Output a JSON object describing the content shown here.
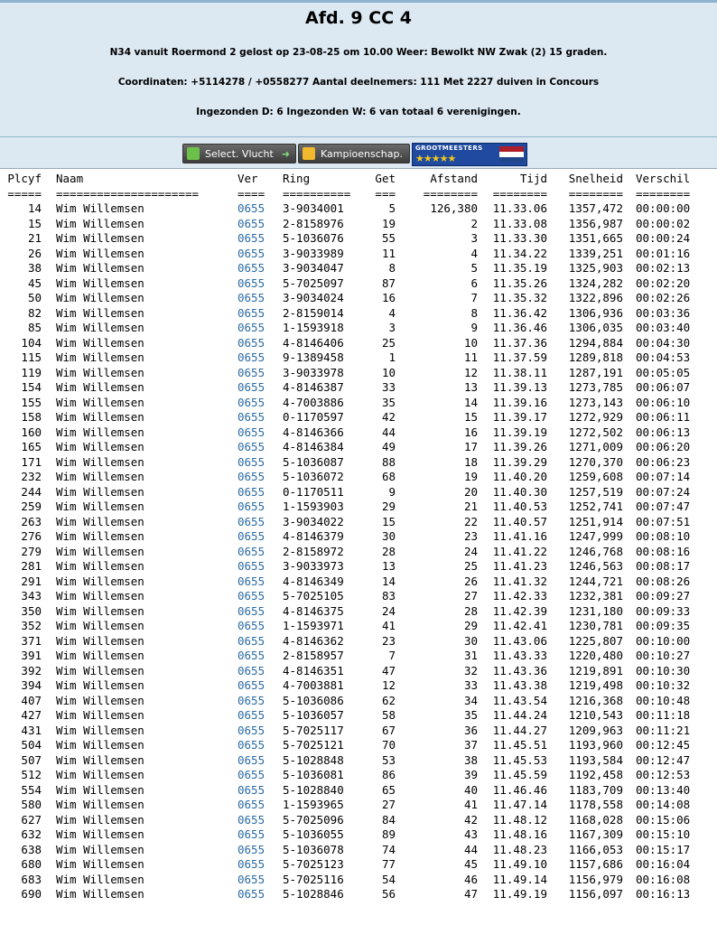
{
  "header": {
    "title": "Afd. 9 CC 4",
    "line1": "N34 vanuit Roermond 2 gelost op 23-08-25 om 10.00 Weer: Bewolkt NW Zwak (2) 15 graden.",
    "line2": "Coordinaten: +5114278 / +0558277 Aantal deelnemers: 111 Met 2227 duiven in Concours",
    "line3": "Ingezonden D: 6 Ingezonden W: 6 van totaal 6 verenigingen."
  },
  "buttons": {
    "select": "Select. Vlucht",
    "kampioen": "Kampioenschap.",
    "grootmeesters": "GROOTMEESTERS",
    "stars": "★★★★★"
  },
  "colors": {
    "header_bg": "#dce8f2",
    "ver_link": "#2a6aa3"
  },
  "table": {
    "columns": [
      "Plcyf",
      "Naam",
      "Ver",
      "Ring",
      "Get",
      "Afstand",
      "Tijd",
      "Snelheid",
      "Verschil"
    ],
    "underline": [
      "=====",
      "=====================",
      "====",
      "==========",
      "===",
      "========",
      "========",
      "========",
      "========"
    ],
    "rows": [
      [
        "14",
        "Wim Willemsen",
        "0655",
        "3-9034001",
        "5",
        "126,380",
        "11.33.06",
        "1357,472",
        "00:00:00"
      ],
      [
        "15",
        "Wim Willemsen",
        "0655",
        "2-8158976",
        "19",
        "2",
        "11.33.08",
        "1356,987",
        "00:00:02"
      ],
      [
        "21",
        "Wim Willemsen",
        "0655",
        "5-1036076",
        "55",
        "3",
        "11.33.30",
        "1351,665",
        "00:00:24"
      ],
      [
        "26",
        "Wim Willemsen",
        "0655",
        "3-9033989",
        "11",
        "4",
        "11.34.22",
        "1339,251",
        "00:01:16"
      ],
      [
        "38",
        "Wim Willemsen",
        "0655",
        "3-9034047",
        "8",
        "5",
        "11.35.19",
        "1325,903",
        "00:02:13"
      ],
      [
        "45",
        "Wim Willemsen",
        "0655",
        "5-7025097",
        "87",
        "6",
        "11.35.26",
        "1324,282",
        "00:02:20"
      ],
      [
        "50",
        "Wim Willemsen",
        "0655",
        "3-9034024",
        "16",
        "7",
        "11.35.32",
        "1322,896",
        "00:02:26"
      ],
      [
        "82",
        "Wim Willemsen",
        "0655",
        "2-8159014",
        "4",
        "8",
        "11.36.42",
        "1306,936",
        "00:03:36"
      ],
      [
        "85",
        "Wim Willemsen",
        "0655",
        "1-1593918",
        "3",
        "9",
        "11.36.46",
        "1306,035",
        "00:03:40"
      ],
      [
        "104",
        "Wim Willemsen",
        "0655",
        "4-8146406",
        "25",
        "10",
        "11.37.36",
        "1294,884",
        "00:04:30"
      ],
      [
        "115",
        "Wim Willemsen",
        "0655",
        "9-1389458",
        "1",
        "11",
        "11.37.59",
        "1289,818",
        "00:04:53"
      ],
      [
        "119",
        "Wim Willemsen",
        "0655",
        "3-9033978",
        "10",
        "12",
        "11.38.11",
        "1287,191",
        "00:05:05"
      ],
      [
        "154",
        "Wim Willemsen",
        "0655",
        "4-8146387",
        "33",
        "13",
        "11.39.13",
        "1273,785",
        "00:06:07"
      ],
      [
        "155",
        "Wim Willemsen",
        "0655",
        "4-7003886",
        "35",
        "14",
        "11.39.16",
        "1273,143",
        "00:06:10"
      ],
      [
        "158",
        "Wim Willemsen",
        "0655",
        "0-1170597",
        "42",
        "15",
        "11.39.17",
        "1272,929",
        "00:06:11"
      ],
      [
        "160",
        "Wim Willemsen",
        "0655",
        "4-8146366",
        "44",
        "16",
        "11.39.19",
        "1272,502",
        "00:06:13"
      ],
      [
        "165",
        "Wim Willemsen",
        "0655",
        "4-8146384",
        "49",
        "17",
        "11.39.26",
        "1271,009",
        "00:06:20"
      ],
      [
        "171",
        "Wim Willemsen",
        "0655",
        "5-1036087",
        "88",
        "18",
        "11.39.29",
        "1270,370",
        "00:06:23"
      ],
      [
        "232",
        "Wim Willemsen",
        "0655",
        "5-1036072",
        "68",
        "19",
        "11.40.20",
        "1259,608",
        "00:07:14"
      ],
      [
        "244",
        "Wim Willemsen",
        "0655",
        "0-1170511",
        "9",
        "20",
        "11.40.30",
        "1257,519",
        "00:07:24"
      ],
      [
        "259",
        "Wim Willemsen",
        "0655",
        "1-1593903",
        "29",
        "21",
        "11.40.53",
        "1252,741",
        "00:07:47"
      ],
      [
        "263",
        "Wim Willemsen",
        "0655",
        "3-9034022",
        "15",
        "22",
        "11.40.57",
        "1251,914",
        "00:07:51"
      ],
      [
        "276",
        "Wim Willemsen",
        "0655",
        "4-8146379",
        "30",
        "23",
        "11.41.16",
        "1247,999",
        "00:08:10"
      ],
      [
        "279",
        "Wim Willemsen",
        "0655",
        "2-8158972",
        "28",
        "24",
        "11.41.22",
        "1246,768",
        "00:08:16"
      ],
      [
        "281",
        "Wim Willemsen",
        "0655",
        "3-9033973",
        "13",
        "25",
        "11.41.23",
        "1246,563",
        "00:08:17"
      ],
      [
        "291",
        "Wim Willemsen",
        "0655",
        "4-8146349",
        "14",
        "26",
        "11.41.32",
        "1244,721",
        "00:08:26"
      ],
      [
        "343",
        "Wim Willemsen",
        "0655",
        "5-7025105",
        "83",
        "27",
        "11.42.33",
        "1232,381",
        "00:09:27"
      ],
      [
        "350",
        "Wim Willemsen",
        "0655",
        "4-8146375",
        "24",
        "28",
        "11.42.39",
        "1231,180",
        "00:09:33"
      ],
      [
        "352",
        "Wim Willemsen",
        "0655",
        "1-1593971",
        "41",
        "29",
        "11.42.41",
        "1230,781",
        "00:09:35"
      ],
      [
        "371",
        "Wim Willemsen",
        "0655",
        "4-8146362",
        "23",
        "30",
        "11.43.06",
        "1225,807",
        "00:10:00"
      ],
      [
        "391",
        "Wim Willemsen",
        "0655",
        "2-8158957",
        "7",
        "31",
        "11.43.33",
        "1220,480",
        "00:10:27"
      ],
      [
        "392",
        "Wim Willemsen",
        "0655",
        "4-8146351",
        "47",
        "32",
        "11.43.36",
        "1219,891",
        "00:10:30"
      ],
      [
        "394",
        "Wim Willemsen",
        "0655",
        "4-7003881",
        "12",
        "33",
        "11.43.38",
        "1219,498",
        "00:10:32"
      ],
      [
        "407",
        "Wim Willemsen",
        "0655",
        "5-1036086",
        "62",
        "34",
        "11.43.54",
        "1216,368",
        "00:10:48"
      ],
      [
        "427",
        "Wim Willemsen",
        "0655",
        "5-1036057",
        "58",
        "35",
        "11.44.24",
        "1210,543",
        "00:11:18"
      ],
      [
        "431",
        "Wim Willemsen",
        "0655",
        "5-7025117",
        "67",
        "36",
        "11.44.27",
        "1209,963",
        "00:11:21"
      ],
      [
        "504",
        "Wim Willemsen",
        "0655",
        "5-7025121",
        "70",
        "37",
        "11.45.51",
        "1193,960",
        "00:12:45"
      ],
      [
        "507",
        "Wim Willemsen",
        "0655",
        "5-1028848",
        "53",
        "38",
        "11.45.53",
        "1193,584",
        "00:12:47"
      ],
      [
        "512",
        "Wim Willemsen",
        "0655",
        "5-1036081",
        "86",
        "39",
        "11.45.59",
        "1192,458",
        "00:12:53"
      ],
      [
        "554",
        "Wim Willemsen",
        "0655",
        "5-1028840",
        "65",
        "40",
        "11.46.46",
        "1183,709",
        "00:13:40"
      ],
      [
        "580",
        "Wim Willemsen",
        "0655",
        "1-1593965",
        "27",
        "41",
        "11.47.14",
        "1178,558",
        "00:14:08"
      ],
      [
        "627",
        "Wim Willemsen",
        "0655",
        "5-7025096",
        "84",
        "42",
        "11.48.12",
        "1168,028",
        "00:15:06"
      ],
      [
        "632",
        "Wim Willemsen",
        "0655",
        "5-1036055",
        "89",
        "43",
        "11.48.16",
        "1167,309",
        "00:15:10"
      ],
      [
        "638",
        "Wim Willemsen",
        "0655",
        "5-1036078",
        "74",
        "44",
        "11.48.23",
        "1166,053",
        "00:15:17"
      ],
      [
        "680",
        "Wim Willemsen",
        "0655",
        "5-7025123",
        "77",
        "45",
        "11.49.10",
        "1157,686",
        "00:16:04"
      ],
      [
        "683",
        "Wim Willemsen",
        "0655",
        "5-7025116",
        "54",
        "46",
        "11.49.14",
        "1156,979",
        "00:16:08"
      ],
      [
        "690",
        "Wim Willemsen",
        "0655",
        "5-1028846",
        "56",
        "47",
        "11.49.19",
        "1156,097",
        "00:16:13"
      ]
    ]
  }
}
